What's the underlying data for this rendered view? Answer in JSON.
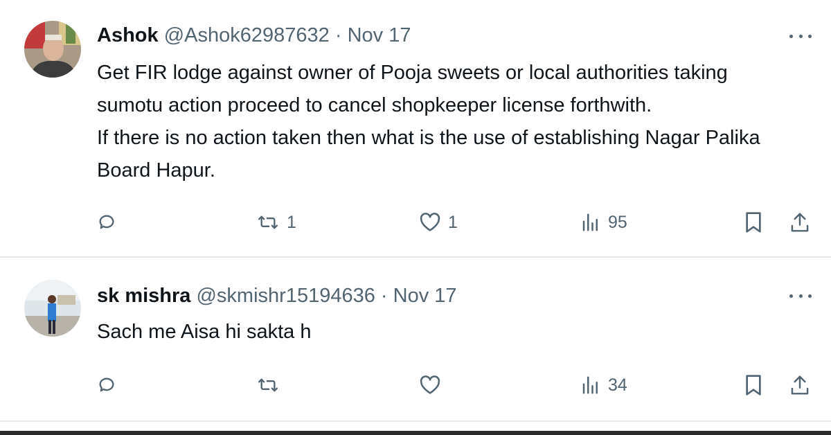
{
  "tweets": [
    {
      "name": "Ashok",
      "handle": "@Ashok62987632",
      "separator": "·",
      "date": "Nov 17",
      "text": "Get FIR lodge against owner of Pooja sweets or  local authorities taking\nsumotu action proceed to cancel shopkeeper license forthwith.\nIf there is no action taken then what is the use of establishing Nagar Palika\nBoard Hapur.",
      "replies": "",
      "reposts": "1",
      "likes": "1",
      "views": "95"
    },
    {
      "name": "sk mishra",
      "handle": "@skmishr15194636",
      "separator": "·",
      "date": "Nov 17",
      "text": "Sach me Aisa hi sakta h",
      "replies": "",
      "reposts": "",
      "likes": "",
      "views": "34"
    }
  ],
  "icons": {
    "reply": "reply-icon",
    "repost": "repost-icon",
    "like": "heart-icon",
    "views": "views-icon",
    "bookmark": "bookmark-icon",
    "share": "share-icon",
    "more": "more-icon"
  },
  "colors": {
    "text": "#0f1419",
    "secondary": "#536471",
    "divider": "#e6e9ec"
  }
}
